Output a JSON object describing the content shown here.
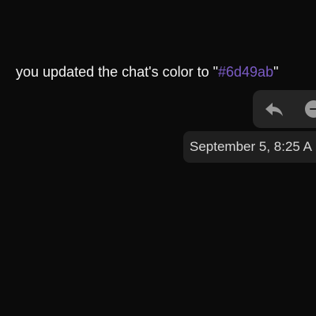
{
  "message": {
    "text_before": "you updated the chat's color to \"",
    "color_code": "#6d49ab",
    "text_after": "\""
  },
  "actions": {
    "reply_icon": "reply-icon",
    "more_icon": "more-icon"
  },
  "tooltip": {
    "timestamp": "September 5, 8:25 A"
  },
  "colors": {
    "background": "#0b0b0b",
    "accent": "#6d49ab"
  }
}
